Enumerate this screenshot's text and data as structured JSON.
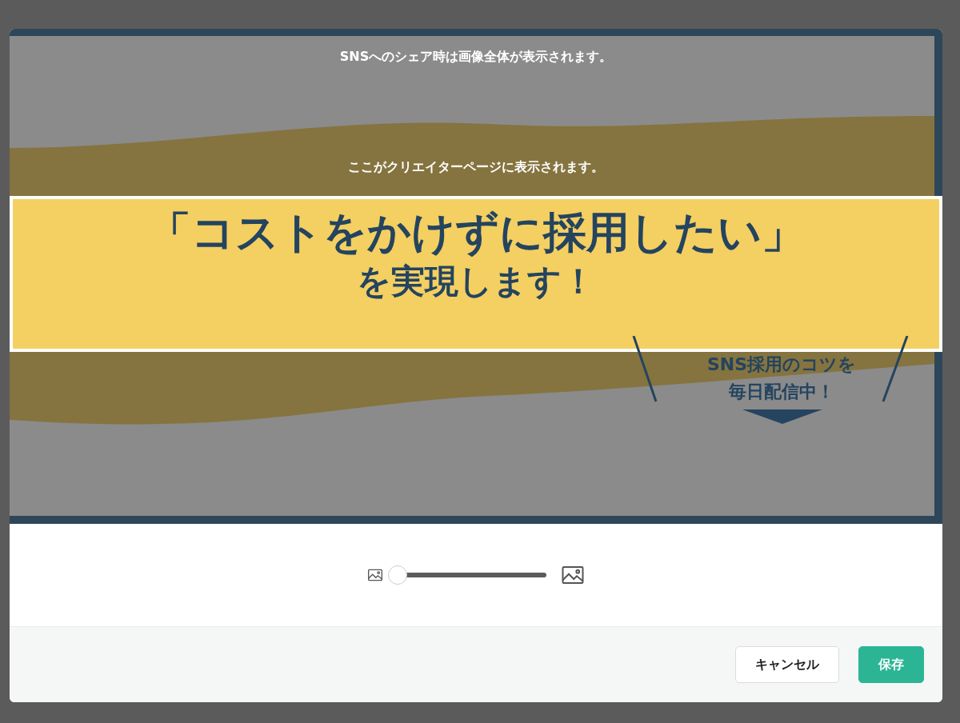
{
  "editor": {
    "share_notice": "SNSへのシェア時は画像全体が表示されます。",
    "creator_notice": "ここがクリエイターページに表示されます。",
    "banner": {
      "headline": "「コストをかけずに採用したい」",
      "subheadline": "を実現します！",
      "callout": [
        "SNS採用のコツを",
        "毎日配信中！"
      ]
    }
  },
  "zoom": {
    "level": 0
  },
  "buttons": [
    {
      "label": "キャンセル",
      "kind": "secondary"
    },
    {
      "label": "保存",
      "kind": "primary"
    }
  ]
}
